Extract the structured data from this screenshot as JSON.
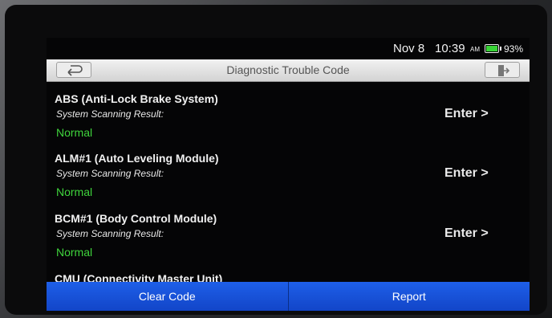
{
  "status": {
    "date": "Nov 8",
    "time": "10:39",
    "ampm": "AM",
    "battery": "93%"
  },
  "header": {
    "title": "Diagnostic Trouble Code",
    "back_icon": "back-arrow-icon",
    "exit_icon": "exit-icon"
  },
  "systems": [
    {
      "name": "ABS (Anti-Lock Brake System)",
      "label": "System Scanning Result:",
      "status": "Normal",
      "action": "Enter >"
    },
    {
      "name": "ALM#1 (Auto Leveling Module)",
      "label": "System Scanning Result:",
      "status": "Normal",
      "action": "Enter >"
    },
    {
      "name": "BCM#1 (Body Control Module)",
      "label": "System Scanning Result:",
      "status": "Normal",
      "action": "Enter >"
    },
    {
      "name": "CMU (Connectivity Master Unit)"
    }
  ],
  "buttons": {
    "clear": "Clear Code",
    "report": "Report"
  },
  "colors": {
    "accent": "#1550d8",
    "status_ok": "#3fd43c"
  }
}
